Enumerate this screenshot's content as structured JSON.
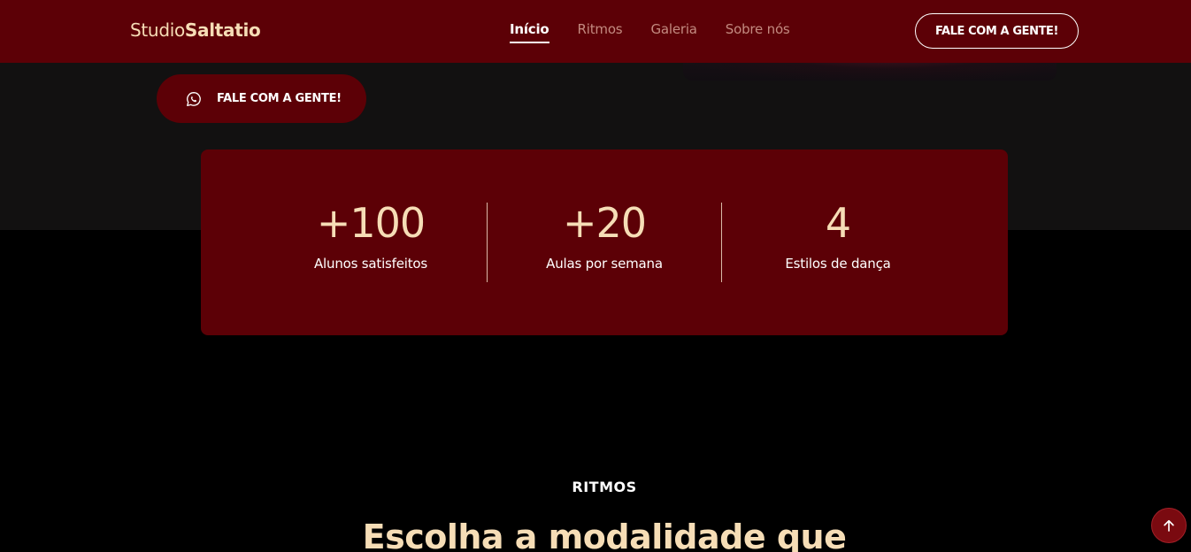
{
  "header": {
    "logo_regular": "Studio",
    "logo_bold": "Saltatio",
    "nav": [
      {
        "label": "Início",
        "active": true
      },
      {
        "label": "Ritmos",
        "active": false
      },
      {
        "label": "Galeria",
        "active": false
      },
      {
        "label": "Sobre nós",
        "active": false
      }
    ],
    "cta_label": "FALE COM A GENTE!"
  },
  "hero": {
    "cta_label": "FALE COM A GENTE!",
    "cta_icon": "whatsapp-icon"
  },
  "stats": [
    {
      "value": "+100",
      "label": "Alunos satisfeitos"
    },
    {
      "value": "+20",
      "label": "Aulas por semana"
    },
    {
      "value": "4",
      "label": "Estilos de dança"
    }
  ],
  "ritmos": {
    "eyebrow": "RITMOS",
    "heading": "Escolha a modalidade que"
  },
  "scroll_top": {
    "icon": "arrow-up-icon"
  },
  "colors": {
    "brand": "#5c0006",
    "accent_text": "#f6ddb6",
    "page_bg": "#000000",
    "hero_bg": "#121111"
  }
}
